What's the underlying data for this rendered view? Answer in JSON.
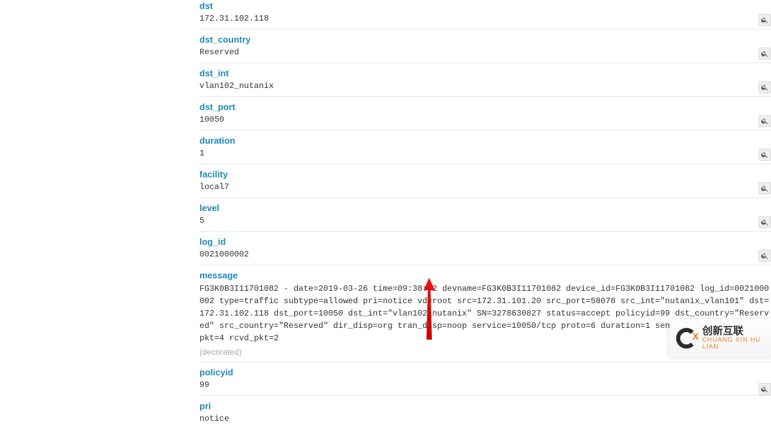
{
  "fields": [
    {
      "label": "dst",
      "value": "172.31.102.118",
      "zoom": true
    },
    {
      "label": "dst_country",
      "value": "Reserved",
      "zoom": true
    },
    {
      "label": "dst_int",
      "value": "vlan102_nutanix",
      "zoom": true
    },
    {
      "label": "dst_port",
      "value": "10050",
      "zoom": true
    },
    {
      "label": "duration",
      "value": "1",
      "zoom": true
    },
    {
      "label": "facility",
      "value": "local7",
      "zoom": true
    },
    {
      "label": "level",
      "value": "5",
      "zoom": true
    },
    {
      "label": "log_id",
      "value": "0021000002",
      "zoom": true
    },
    {
      "label": "message",
      "value": "FG3K0B3I11701082 - date=2019-03-26 time=09:38:42 devname=FG3K0B3I11701082 device_id=FG3K0B3I11701082 log_id=0021000002 type=traffic subtype=allowed pri=notice vd=root src=172.31.101.20 src_port=58078 src_int=\"nutanix_vlan101\" dst=172.31.102.118 dst_port=10050 dst_int=\"vlan102_nutanix\" SN=3278630827 status=accept policyid=99 dst_country=\"Reserved\" src_country=\"Reserved\" dir_disp=org tran_disp=noop service=10050/tcp proto=6 duration=1 sent=244 rcvd=112 sent_pkt=4 rcvd_pkt=2",
      "zoom": false,
      "decorated": "(decorated)"
    },
    {
      "label": "policyid",
      "value": "99",
      "zoom": true
    },
    {
      "label": "pri",
      "value": "notice",
      "zoom": true
    }
  ],
  "watermark": {
    "brand": "创新互联",
    "sub": "CHUANG XIN HU LIAN"
  }
}
